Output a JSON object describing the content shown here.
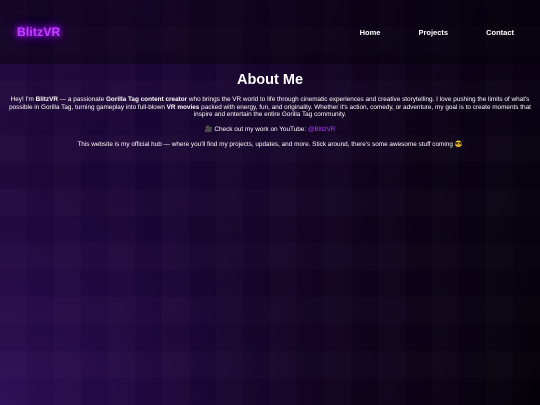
{
  "header": {
    "logo": "BlitzVR",
    "nav": [
      "Home",
      "Projects",
      "Contact"
    ]
  },
  "about": {
    "title": "About Me",
    "intro": {
      "t1": "Hey! I'm ",
      "name": "BlitzVR",
      "t2": " — a passionate ",
      "role": "Gorilla Tag content creator",
      "t3": " who brings the VR world to life through cinematic experiences and creative storytelling. I love pushing the limits of what's possible in Gorilla Tag, turning gameplay into full-blown ",
      "movies": "VR movies",
      "t4": " packed with energy, fun, and originality. Whether it's action, comedy, or adventure, my goal is to create moments that inspire and entertain the entire Gorilla Tag community."
    },
    "youtube": {
      "emoji": "🎥",
      "text": " Check out my work on YouTube: ",
      "handle": "@BlitzVR"
    },
    "hub": {
      "text": "This website is my official hub — where you'll find my projects, updates, and more. Stick around, there's some awesome stuff coming ",
      "emoji": "😎"
    }
  },
  "colors": {
    "accent": "#c040ff",
    "link": "#b040ff",
    "background": "#0f0320"
  }
}
